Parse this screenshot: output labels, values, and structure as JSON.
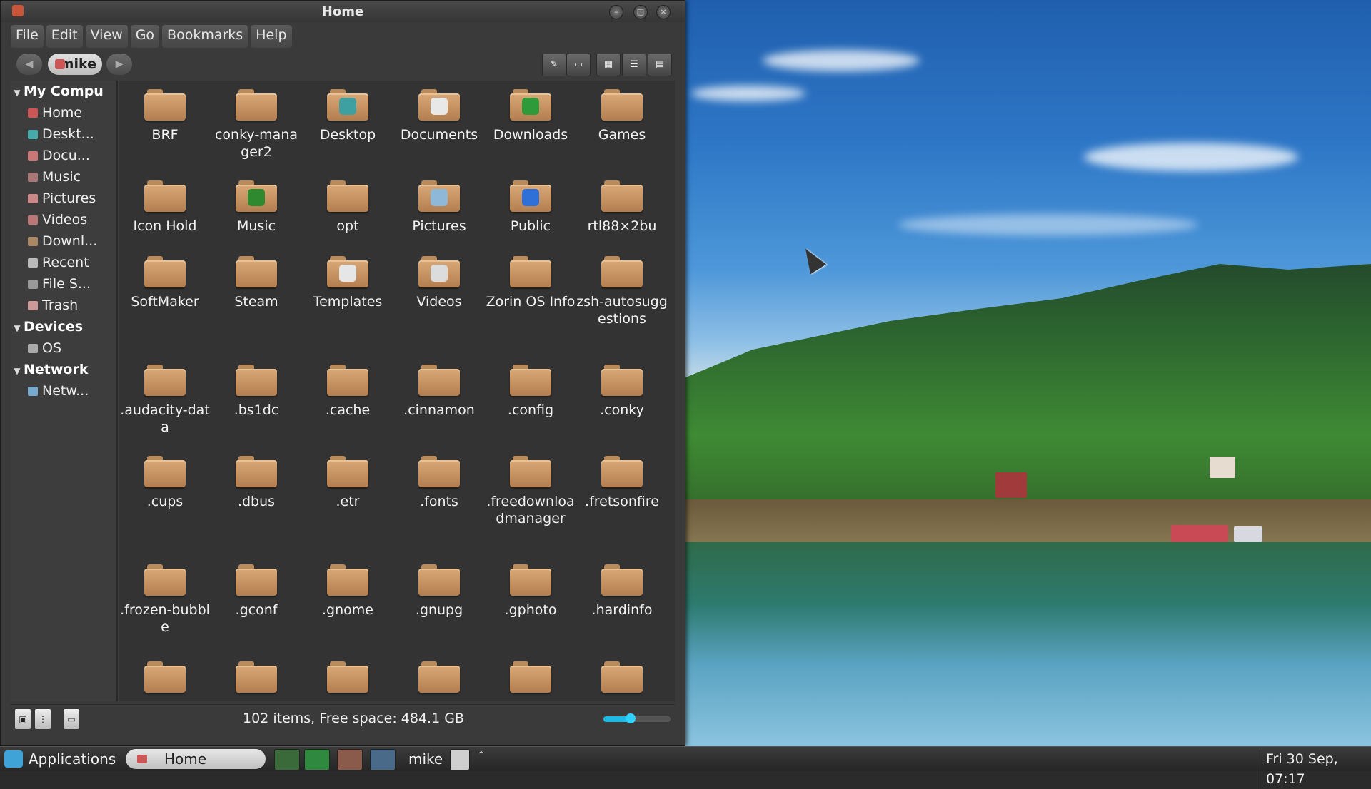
{
  "window": {
    "title": "Home"
  },
  "menubar": [
    "File",
    "Edit",
    "View",
    "Go",
    "Bookmarks",
    "Help"
  ],
  "toolbar": {
    "breadcrumb": "mike"
  },
  "sidebar": {
    "sections": [
      {
        "title": "My Compu",
        "items": [
          "Home",
          "Deskt...",
          "Docu...",
          "Music",
          "Pictures",
          "Videos",
          "Downl...",
          "Recent",
          "File S...",
          "Trash"
        ]
      },
      {
        "title": "Devices",
        "items": [
          "OS"
        ]
      },
      {
        "title": "Network",
        "items": [
          "Netw..."
        ]
      }
    ]
  },
  "files": [
    {
      "name": "BRF"
    },
    {
      "name": "conky-manager2"
    },
    {
      "name": "Desktop",
      "emblem": "desktop"
    },
    {
      "name": "Documents",
      "emblem": "documents"
    },
    {
      "name": "Downloads",
      "emblem": "download"
    },
    {
      "name": "Games"
    },
    {
      "name": "Icon Hold"
    },
    {
      "name": "Music",
      "emblem": "music"
    },
    {
      "name": "opt"
    },
    {
      "name": "Pictures",
      "emblem": "pictures"
    },
    {
      "name": "Public",
      "emblem": "public"
    },
    {
      "name": "rtl88×2bu"
    },
    {
      "name": "SoftMaker"
    },
    {
      "name": "Steam"
    },
    {
      "name": "Templates",
      "emblem": "templates"
    },
    {
      "name": "Videos",
      "emblem": "videos"
    },
    {
      "name": "Zorin OS Info"
    },
    {
      "name": "zsh-autosuggestions"
    },
    {
      "name": ".audacity-data"
    },
    {
      "name": ".bs1dc"
    },
    {
      "name": ".cache"
    },
    {
      "name": ".cinnamon"
    },
    {
      "name": ".config"
    },
    {
      "name": ".conky"
    },
    {
      "name": ".cups"
    },
    {
      "name": ".dbus"
    },
    {
      "name": ".etr"
    },
    {
      "name": ".fonts"
    },
    {
      "name": ".freedownloadmanager"
    },
    {
      "name": ".fretsonfire"
    },
    {
      "name": ".frozen-bubble"
    },
    {
      "name": ".gconf"
    },
    {
      "name": ".gnome"
    },
    {
      "name": ".gnupg"
    },
    {
      "name": ".gphoto"
    },
    {
      "name": ".hardinfo"
    },
    {
      "name": ""
    },
    {
      "name": ""
    },
    {
      "name": ""
    },
    {
      "name": ""
    },
    {
      "name": ""
    },
    {
      "name": ""
    }
  ],
  "statusbar": {
    "text": "102 items, Free space: 484.1 GB",
    "zoom_level": 0.4
  },
  "taskbar": {
    "menu_label": "Applications",
    "task_label": "Home",
    "user": "mike",
    "clock": "Fri 30 Sep, 07:17"
  },
  "colors": {
    "accent": "#1fb9e6",
    "folder": "#c9935f"
  }
}
